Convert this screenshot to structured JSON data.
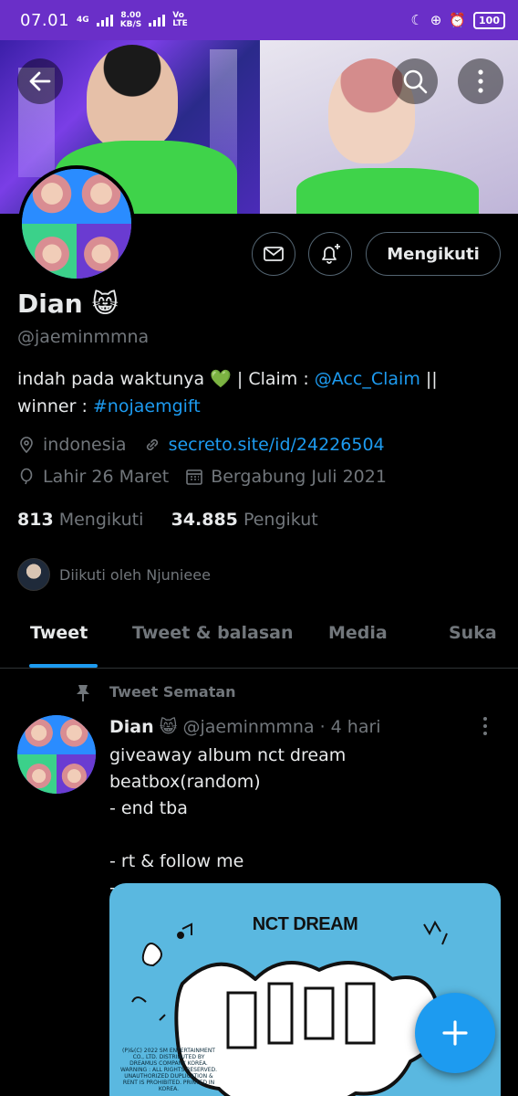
{
  "status_bar": {
    "time": "07.01",
    "network": "4G",
    "speed_value": "8.00",
    "speed_unit": "KB/S",
    "carrier": "Vo LTE",
    "battery": "100"
  },
  "header": {
    "back_icon": "arrow-left-icon",
    "search_icon": "search-icon",
    "more_icon": "more-vertical-icon"
  },
  "profile": {
    "name": "Dian",
    "name_emoji": "😸",
    "handle": "@jaeminmmna",
    "follow_label": "Mengikuti",
    "bio_part1": "indah pada waktunya 💚  | Claim : ",
    "bio_mention": "@Acc_Claim",
    "bio_part2": " || winner : ",
    "bio_hashtag": "#nojaemgift",
    "location": "indonesia",
    "website": "secreto.site/id/24226504",
    "birthday": "Lahir 26 Maret",
    "joined": "Bergabung Juli 2021",
    "following_count": "813",
    "following_label": "Mengikuti",
    "followers_count": "34.885",
    "followers_label": "Pengikut",
    "followed_by": "Diikuti oleh Njunieee"
  },
  "tabs": [
    {
      "label": "Tweet",
      "active": true
    },
    {
      "label": "Tweet & balasan",
      "active": false
    },
    {
      "label": "Media",
      "active": false
    },
    {
      "label": "Suka",
      "active": false
    }
  ],
  "pinned_tweet": {
    "pinned_label": "Tweet Sematan",
    "author_name": "Dian",
    "author_emoji": "😸",
    "author_handle": "@jaeminmmna",
    "separator": "·",
    "time": "4 hari",
    "text": "giveaway album nct dream beatbox(random)\n- end tba\n\n- rt & follow me\n- rep",
    "image_title": "NCT DREAM",
    "image_fineprint": "(P)&(C) 2022 SM ENTERTAINMENT CO., LTD. DISTRIBUTED BY DREAMUS COMPANY KOREA. WARNING : ALL RIGHTS RESERVED. UNAUTHORIZED DUPLICATION & RENT IS PROHIBITED. PRINTED IN KOREA."
  },
  "colors": {
    "status_bar": "#6a2fc8",
    "accent": "#1d9bf0",
    "background": "#000000",
    "secondary_text": "#71767b"
  }
}
